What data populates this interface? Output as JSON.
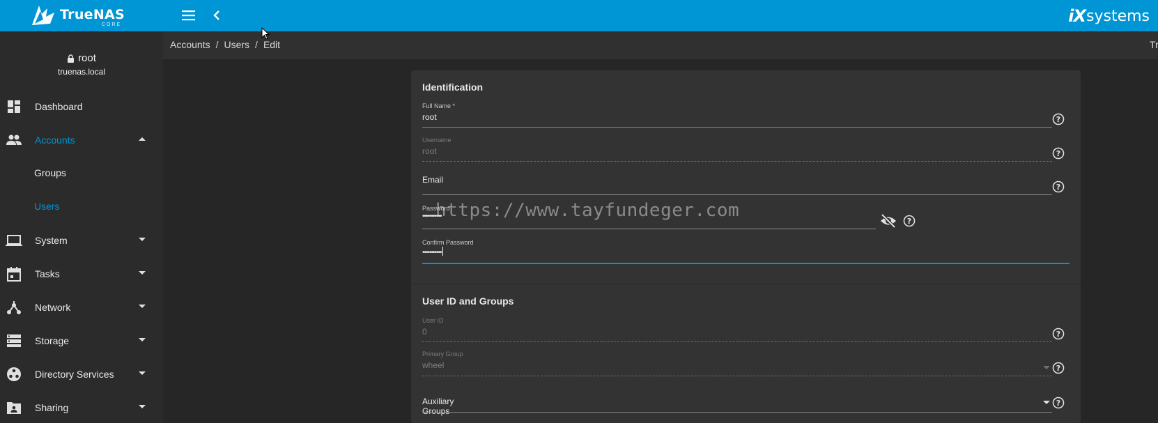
{
  "app": {
    "brand": "TrueNAS",
    "brand_sub": "CORE",
    "vendor_prefix": "iX",
    "vendor_suffix": "systems"
  },
  "user": {
    "name": "root",
    "host": "truenas.local"
  },
  "sidebar": {
    "items": [
      {
        "label": "Dashboard",
        "icon": "dashboard-icon"
      },
      {
        "label": "Accounts",
        "icon": "people-icon",
        "expanded": true,
        "active": true
      },
      {
        "label": "System",
        "icon": "laptop-icon"
      },
      {
        "label": "Tasks",
        "icon": "calendar-icon"
      },
      {
        "label": "Network",
        "icon": "network-icon"
      },
      {
        "label": "Storage",
        "icon": "storage-icon"
      },
      {
        "label": "Directory Services",
        "icon": "directory-icon"
      },
      {
        "label": "Sharing",
        "icon": "sharing-icon"
      }
    ],
    "accounts_sub": [
      {
        "label": "Groups",
        "active": false
      },
      {
        "label": "Users",
        "active": true
      }
    ]
  },
  "breadcrumb": {
    "items": [
      "Accounts",
      "Users",
      "Edit"
    ],
    "separator": "/",
    "right_text": "Tr"
  },
  "form": {
    "identification": {
      "title": "Identification",
      "full_name": {
        "label": "Full Name *",
        "value": "root"
      },
      "username": {
        "label": "Username",
        "value": "root",
        "disabled": true
      },
      "email": {
        "placeholder": "Email",
        "value": ""
      },
      "password": {
        "label": "Password",
        "value": "•••••••••••"
      },
      "confirm_password": {
        "label": "Confirm Password",
        "value": "•••••••••••"
      }
    },
    "user_id_groups": {
      "title": "User ID and Groups",
      "user_id": {
        "label": "User ID",
        "value": "0",
        "disabled": true
      },
      "primary_group": {
        "label": "Primary Group",
        "value": "wheel",
        "disabled": true
      },
      "auxiliary_groups": {
        "placeholder": "Auxiliary Groups",
        "value": ""
      }
    }
  },
  "watermark": "https://www.tayfundeger.com",
  "colors": {
    "accent": "#0095d5",
    "topbar": "#0095d5",
    "sidebar_bg": "#2b2b2b",
    "card_bg": "#333333",
    "page_bg": "#262626"
  }
}
